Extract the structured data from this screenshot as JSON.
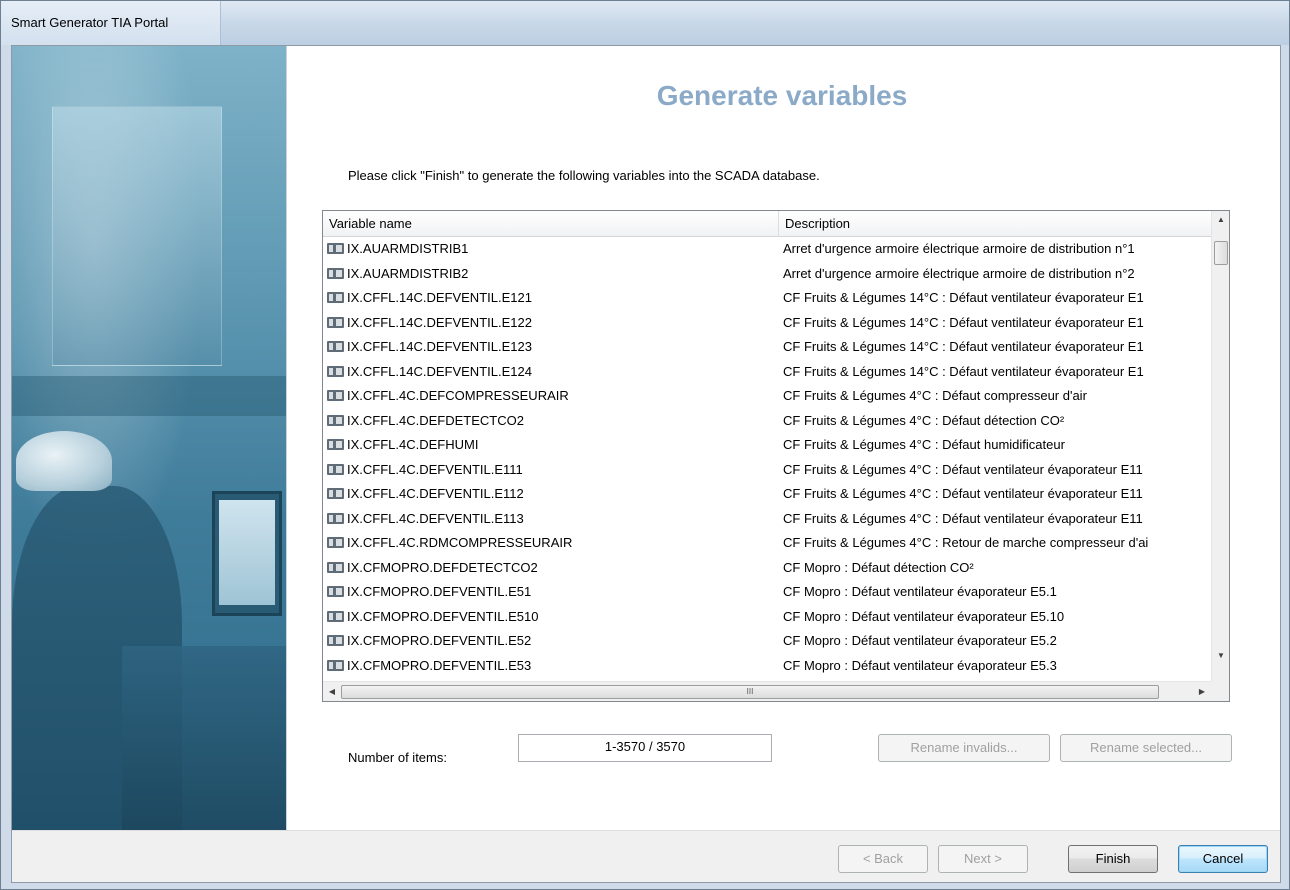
{
  "window": {
    "title": "Smart Generator TIA Portal"
  },
  "page": {
    "heading": "Generate variables",
    "instruction": "Please click \"Finish\" to generate the following variables into the SCADA database."
  },
  "grid": {
    "columns": [
      "Variable name",
      "Description"
    ],
    "rows": [
      {
        "name": "IX.AUARMDISTRIB1",
        "desc": "Arret d'urgence armoire électrique armoire de distribution n°1"
      },
      {
        "name": "IX.AUARMDISTRIB2",
        "desc": "Arret d'urgence armoire électrique armoire de distribution n°2"
      },
      {
        "name": "IX.CFFL.14C.DEFVENTIL.E121",
        "desc": "CF Fruits & Légumes 14°C : Défaut ventilateur évaporateur E1"
      },
      {
        "name": "IX.CFFL.14C.DEFVENTIL.E122",
        "desc": "CF Fruits & Légumes 14°C : Défaut ventilateur évaporateur E1"
      },
      {
        "name": "IX.CFFL.14C.DEFVENTIL.E123",
        "desc": "CF Fruits & Légumes 14°C : Défaut ventilateur évaporateur E1"
      },
      {
        "name": "IX.CFFL.14C.DEFVENTIL.E124",
        "desc": "CF Fruits & Légumes 14°C : Défaut ventilateur évaporateur E1"
      },
      {
        "name": "IX.CFFL.4C.DEFCOMPRESSEURAIR",
        "desc": "CF Fruits & Légumes 4°C : Défaut compresseur d'air"
      },
      {
        "name": "IX.CFFL.4C.DEFDETECTCO2",
        "desc": "CF Fruits & Légumes 4°C : Défaut détection CO²"
      },
      {
        "name": "IX.CFFL.4C.DEFHUMI",
        "desc": "CF Fruits & Légumes 4°C : Défaut humidificateur"
      },
      {
        "name": "IX.CFFL.4C.DEFVENTIL.E111",
        "desc": "CF Fruits & Légumes 4°C : Défaut ventilateur évaporateur E11"
      },
      {
        "name": "IX.CFFL.4C.DEFVENTIL.E112",
        "desc": "CF Fruits & Légumes 4°C : Défaut ventilateur évaporateur E11"
      },
      {
        "name": "IX.CFFL.4C.DEFVENTIL.E113",
        "desc": "CF Fruits & Légumes 4°C : Défaut ventilateur évaporateur E11"
      },
      {
        "name": "IX.CFFL.4C.RDMCOMPRESSEURAIR",
        "desc": "CF Fruits & Légumes 4°C : Retour de marche compresseur d'ai"
      },
      {
        "name": "IX.CFMOPRO.DEFDETECTCO2",
        "desc": "CF Mopro : Défaut détection CO²"
      },
      {
        "name": "IX.CFMOPRO.DEFVENTIL.E51",
        "desc": "CF Mopro : Défaut ventilateur évaporateur E5.1"
      },
      {
        "name": "IX.CFMOPRO.DEFVENTIL.E510",
        "desc": "CF Mopro : Défaut ventilateur évaporateur E5.10"
      },
      {
        "name": "IX.CFMOPRO.DEFVENTIL.E52",
        "desc": "CF Mopro : Défaut ventilateur évaporateur E5.2"
      },
      {
        "name": "IX.CFMOPRO.DEFVENTIL.E53",
        "desc": "CF Mopro : Défaut ventilateur évaporateur E5.3"
      }
    ],
    "row_icon": "variable-icon",
    "scroll_up": "▲",
    "scroll_down": "▼",
    "scroll_left": "◀",
    "scroll_right": "▶",
    "scroll_grip": "III"
  },
  "info": {
    "count_label": "Number of items:",
    "count_value": "1-3570 / 3570"
  },
  "buttons": {
    "rename_invalids": "Rename invalids...",
    "rename_selected": "Rename selected...",
    "back": "< Back",
    "next": "Next >",
    "finish": "Finish",
    "cancel": "Cancel"
  },
  "colors": {
    "heading": "#8aaac8",
    "default_button_border": "#3c7fb1"
  }
}
